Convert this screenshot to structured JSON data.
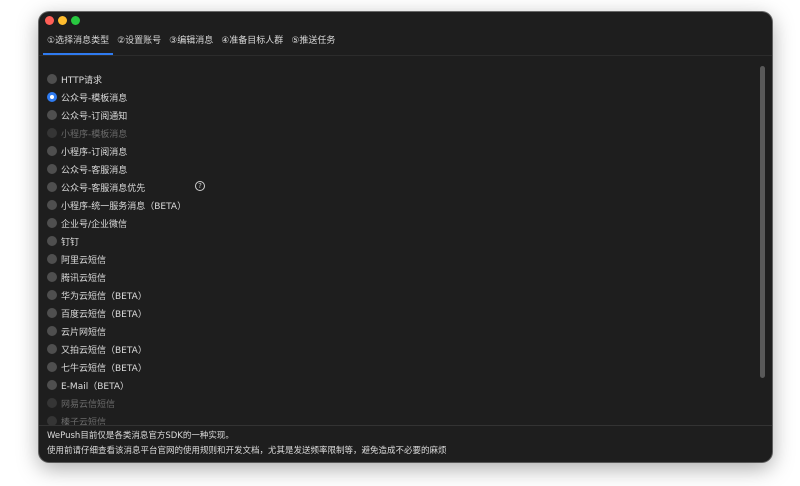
{
  "tabs": [
    {
      "label": "①选择消息类型",
      "active": true
    },
    {
      "label": "②设置账号",
      "active": false
    },
    {
      "label": "③编辑消息",
      "active": false
    },
    {
      "label": "④准备目标人群",
      "active": false
    },
    {
      "label": "⑤推送任务",
      "active": false
    }
  ],
  "options": [
    {
      "label": "HTTP请求",
      "checked": false,
      "disabled": false
    },
    {
      "label": "公众号-模板消息",
      "checked": true,
      "disabled": false
    },
    {
      "label": "公众号-订阅通知",
      "checked": false,
      "disabled": false
    },
    {
      "label": "小程序-模板消息",
      "checked": false,
      "disabled": true
    },
    {
      "label": "小程序-订阅消息",
      "checked": false,
      "disabled": false
    },
    {
      "label": "公众号-客服消息",
      "checked": false,
      "disabled": false
    },
    {
      "label": "公众号-客服消息优先",
      "checked": false,
      "disabled": false
    },
    {
      "label": "小程序-统一服务消息（BETA）",
      "checked": false,
      "disabled": false
    },
    {
      "label": "企业号/企业微信",
      "checked": false,
      "disabled": false
    },
    {
      "label": "钉钉",
      "checked": false,
      "disabled": false
    },
    {
      "label": "阿里云短信",
      "checked": false,
      "disabled": false
    },
    {
      "label": "腾讯云短信",
      "checked": false,
      "disabled": false
    },
    {
      "label": "华为云短信（BETA）",
      "checked": false,
      "disabled": false
    },
    {
      "label": "百度云短信（BETA）",
      "checked": false,
      "disabled": false
    },
    {
      "label": "云片网短信",
      "checked": false,
      "disabled": false
    },
    {
      "label": "又拍云短信（BETA）",
      "checked": false,
      "disabled": false
    },
    {
      "label": "七牛云短信（BETA）",
      "checked": false,
      "disabled": false
    },
    {
      "label": "E-Mail（BETA）",
      "checked": false,
      "disabled": false
    },
    {
      "label": "网易云信短信",
      "checked": false,
      "disabled": true
    },
    {
      "label": "榛子云短信",
      "checked": false,
      "disabled": true
    }
  ],
  "help_icon": {
    "name": "question-circle-icon",
    "glyph": "?"
  },
  "footer": {
    "line1": "WePush目前仅是各类消息官方SDK的一种实现。",
    "line2": "使用前请仔细查看该消息平台官网的使用规则和开发文档，尤其是发送频率限制等，避免造成不必要的麻烦"
  },
  "colors": {
    "accent": "#2f7bf0",
    "window_bg": "#1e1e1e",
    "close": "#ff5f57",
    "minimize": "#febc2e",
    "maximize": "#28c840"
  }
}
